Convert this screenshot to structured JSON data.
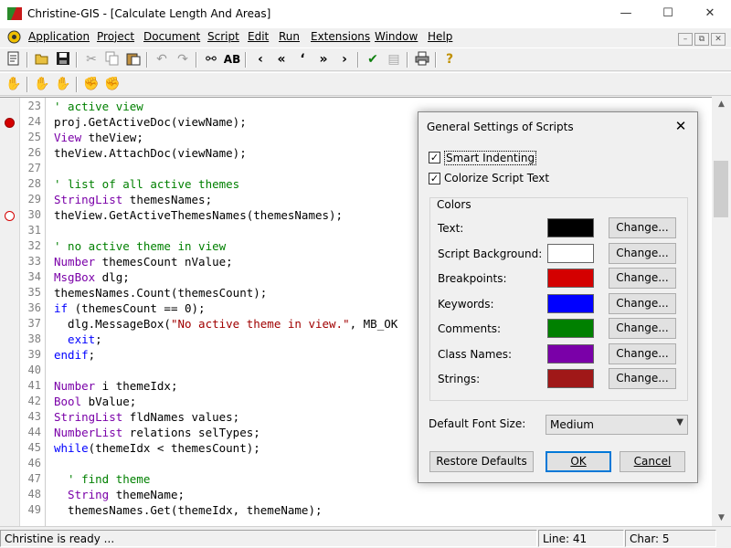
{
  "window": {
    "title": "Christine-GIS - [Calculate Length And Areas]",
    "minimize": "—",
    "maximize": "☐",
    "close": "✕"
  },
  "menubar": {
    "items": [
      "Application",
      "Project",
      "Document",
      "Script",
      "Edit",
      "Run",
      "Extensions",
      "Window",
      "Help"
    ]
  },
  "mdi_controls": {
    "minimize": "–",
    "restore": "⧉",
    "close": "✕"
  },
  "toolbar1_icons": [
    "new-script-icon",
    "open-folder-icon",
    "save-icon",
    "cut-icon",
    "copy-icon",
    "paste-icon",
    "undo-icon",
    "redo-icon",
    "find-icon",
    "replace-icon",
    "first-icon",
    "previous-icon",
    "step-icon",
    "next-icon",
    "last-icon",
    "compile-check-icon",
    "stop-icon",
    "print-icon",
    "help-icon"
  ],
  "toolbar2_icons": [
    "hand-icon",
    "hand-disabled-icon",
    "hand-no-icon",
    "hand-grab-disabled-icon",
    "hand-grab-icon"
  ],
  "editor": {
    "lines": [
      {
        "n": "23",
        "segs": [
          [
            "cm",
            "' active view"
          ]
        ]
      },
      {
        "n": "24",
        "segs": [
          [
            "",
            "proj.GetActiveDoc(viewName);"
          ]
        ],
        "bp": "filled"
      },
      {
        "n": "25",
        "segs": [
          [
            "cls",
            "View"
          ],
          [
            "",
            " theView;"
          ]
        ]
      },
      {
        "n": "26",
        "segs": [
          [
            "",
            "theView.AttachDoc(viewName);"
          ]
        ]
      },
      {
        "n": "27",
        "segs": []
      },
      {
        "n": "28",
        "segs": [
          [
            "cm",
            "' list of all active themes"
          ]
        ]
      },
      {
        "n": "29",
        "segs": [
          [
            "cls",
            "StringList"
          ],
          [
            "",
            " themesNames;"
          ]
        ]
      },
      {
        "n": "30",
        "segs": [
          [
            "",
            "theView.GetActiveThemesNames(themesNames);"
          ]
        ],
        "bp": "hollow"
      },
      {
        "n": "31",
        "segs": []
      },
      {
        "n": "32",
        "segs": [
          [
            "cm",
            "' no active theme in view"
          ]
        ]
      },
      {
        "n": "33",
        "segs": [
          [
            "cls",
            "Number"
          ],
          [
            "",
            " themesCount nValue;"
          ]
        ]
      },
      {
        "n": "34",
        "segs": [
          [
            "cls",
            "MsgBox"
          ],
          [
            "",
            " dlg;"
          ]
        ]
      },
      {
        "n": "35",
        "segs": [
          [
            "",
            "themesNames.Count(themesCount);"
          ]
        ]
      },
      {
        "n": "36",
        "segs": [
          [
            "kw",
            "if"
          ],
          [
            "",
            " (themesCount == 0);"
          ]
        ]
      },
      {
        "n": "37",
        "segs": [
          [
            "",
            "  dlg.MessageBox("
          ],
          [
            "str",
            "\"No active theme in view.\""
          ],
          [
            "",
            ", MB_OK"
          ]
        ]
      },
      {
        "n": "38",
        "segs": [
          [
            "kw",
            "  exit"
          ],
          [
            "",
            ";"
          ]
        ]
      },
      {
        "n": "39",
        "segs": [
          [
            "kw",
            "endif"
          ],
          [
            "",
            ";"
          ]
        ]
      },
      {
        "n": "40",
        "segs": []
      },
      {
        "n": "41",
        "segs": [
          [
            "cls",
            "Number"
          ],
          [
            "",
            " i themeIdx;"
          ]
        ]
      },
      {
        "n": "42",
        "segs": [
          [
            "cls",
            "Bool"
          ],
          [
            "",
            " bValue;"
          ]
        ]
      },
      {
        "n": "43",
        "segs": [
          [
            "cls",
            "StringList"
          ],
          [
            "",
            " fldNames values;"
          ]
        ]
      },
      {
        "n": "44",
        "segs": [
          [
            "cls",
            "NumberList"
          ],
          [
            "",
            " relations selTypes;"
          ]
        ]
      },
      {
        "n": "45",
        "segs": [
          [
            "kw",
            "while"
          ],
          [
            "",
            "(themeIdx < themesCount);"
          ]
        ]
      },
      {
        "n": "46",
        "segs": []
      },
      {
        "n": "47",
        "segs": [
          [
            "cm",
            "  ' find theme"
          ]
        ]
      },
      {
        "n": "48",
        "segs": [
          [
            "cls",
            "  String"
          ],
          [
            "",
            " themeName;"
          ]
        ]
      },
      {
        "n": "49",
        "segs": [
          [
            "",
            "  themesNames.Get(themeIdx, themeName);"
          ]
        ]
      }
    ]
  },
  "statusbar": {
    "message": "Christine is ready ...",
    "line": "Line: 41",
    "char": "Char: 5"
  },
  "dialog": {
    "title": "General Settings of Scripts",
    "close": "✕",
    "smart_indenting": {
      "label": "Smart Indenting",
      "checked": true
    },
    "colorize": {
      "label": "Colorize Script Text",
      "checked": true
    },
    "colors_legend": "Colors",
    "colors": [
      {
        "label": "Text:",
        "hex": "#000000"
      },
      {
        "label": "Script Background:",
        "hex": "#ffffff"
      },
      {
        "label": "Breakpoints:",
        "hex": "#d40000"
      },
      {
        "label": "Keywords:",
        "hex": "#0000ff"
      },
      {
        "label": "Comments:",
        "hex": "#008000"
      },
      {
        "label": "Class Names:",
        "hex": "#7a00a8"
      },
      {
        "label": "Strings:",
        "hex": "#a01818"
      }
    ],
    "change_label": "Change...",
    "font_size_label": "Default Font Size:",
    "font_size_value": "Medium",
    "restore_label": "Restore Defaults",
    "ok_label": "OK",
    "cancel_label": "Cancel"
  }
}
